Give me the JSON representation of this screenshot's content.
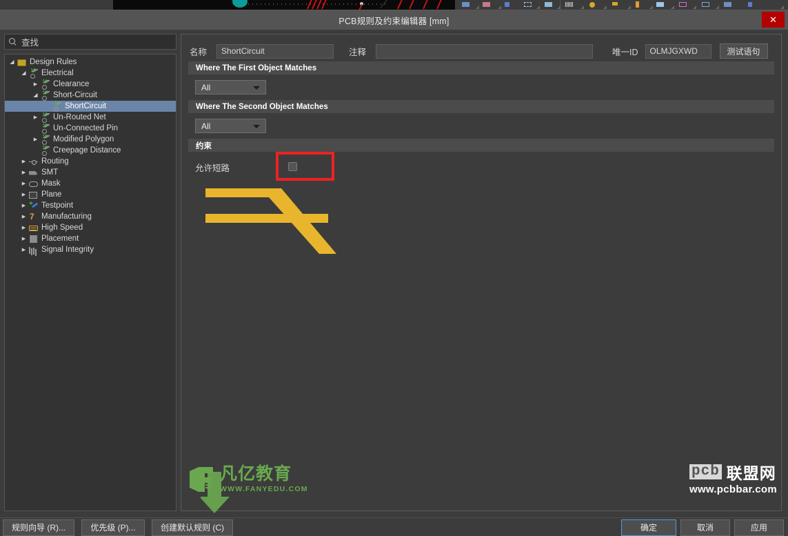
{
  "window": {
    "title": "PCB规则及约束编辑器 [mm]",
    "close_label": "✕"
  },
  "search": {
    "placeholder": "查找",
    "icon": "search-icon"
  },
  "tree": {
    "nodes": [
      {
        "label": "Design Rules",
        "depth": 0,
        "arrow": "down",
        "icon": "folder-rules-icon",
        "selected": false
      },
      {
        "label": "Electrical",
        "depth": 1,
        "arrow": "down",
        "icon": "electrical-rule-icon",
        "selected": false
      },
      {
        "label": "Clearance",
        "depth": 2,
        "arrow": "right",
        "icon": "electrical-rule-icon",
        "selected": false
      },
      {
        "label": "Short-Circuit",
        "depth": 2,
        "arrow": "down",
        "icon": "electrical-rule-icon",
        "selected": false
      },
      {
        "label": "ShortCircuit",
        "depth": 3,
        "arrow": "none",
        "icon": "electrical-rule-icon",
        "selected": true
      },
      {
        "label": "Un-Routed Net",
        "depth": 2,
        "arrow": "right",
        "icon": "electrical-rule-icon",
        "selected": false
      },
      {
        "label": "Un-Connected Pin",
        "depth": 2,
        "arrow": "none",
        "icon": "electrical-rule-icon",
        "selected": false
      },
      {
        "label": "Modified Polygon",
        "depth": 2,
        "arrow": "right",
        "icon": "electrical-rule-icon",
        "selected": false
      },
      {
        "label": "Creepage Distance",
        "depth": 2,
        "arrow": "none",
        "icon": "electrical-rule-icon",
        "selected": false
      },
      {
        "label": "Routing",
        "depth": 1,
        "arrow": "right",
        "icon": "routing-icon",
        "selected": false
      },
      {
        "label": "SMT",
        "depth": 1,
        "arrow": "right",
        "icon": "smt-icon",
        "selected": false
      },
      {
        "label": "Mask",
        "depth": 1,
        "arrow": "right",
        "icon": "mask-icon",
        "selected": false
      },
      {
        "label": "Plane",
        "depth": 1,
        "arrow": "right",
        "icon": "plane-icon",
        "selected": false
      },
      {
        "label": "Testpoint",
        "depth": 1,
        "arrow": "right",
        "icon": "testpoint-icon",
        "selected": false
      },
      {
        "label": "Manufacturing",
        "depth": 1,
        "arrow": "right",
        "icon": "manufacturing-icon",
        "selected": false
      },
      {
        "label": "High Speed",
        "depth": 1,
        "arrow": "right",
        "icon": "high-speed-icon",
        "selected": false
      },
      {
        "label": "Placement",
        "depth": 1,
        "arrow": "right",
        "icon": "placement-icon",
        "selected": false
      },
      {
        "label": "Signal Integrity",
        "depth": 1,
        "arrow": "right",
        "icon": "signal-integrity-icon",
        "selected": false
      }
    ]
  },
  "form": {
    "name_label": "名称",
    "name_value": "ShortCircuit",
    "comment_label": "注释",
    "comment_value": "",
    "uid_label": "唯一ID",
    "uid_value": "OLMJGXWD",
    "test_query_button": "测试语句"
  },
  "sections": {
    "first_object": {
      "header": "Where The First Object Matches",
      "scope_value": "All"
    },
    "second_object": {
      "header": "Where The Second Object Matches",
      "scope_value": "All"
    },
    "constraints": {
      "header": "约束",
      "allow_short_circuit_label": "允许短路",
      "allow_short_circuit_checked": false
    }
  },
  "watermarks": {
    "left_cn": "凡亿教育",
    "left_url": "WWW.FANYEDU.COM",
    "right_badge": "pcb",
    "right_cn": "联盟网",
    "right_url": "www.pcbbar.com"
  },
  "bottom_bar": {
    "rule_wizard": "规则向导 (R)...",
    "priority": "优先级 (P)...",
    "create_default_rules": "创建默认规则 (C)",
    "ok": "确定",
    "cancel": "取消",
    "apply": "应用"
  },
  "colors": {
    "accent_selection": "#6a85a8",
    "close_red": "#b40000",
    "highlight_red": "#ee2222",
    "annotation_yellow": "#e8b52c",
    "annotation_green": "#6aa84f",
    "primary_border_blue": "#4f9ddb"
  }
}
